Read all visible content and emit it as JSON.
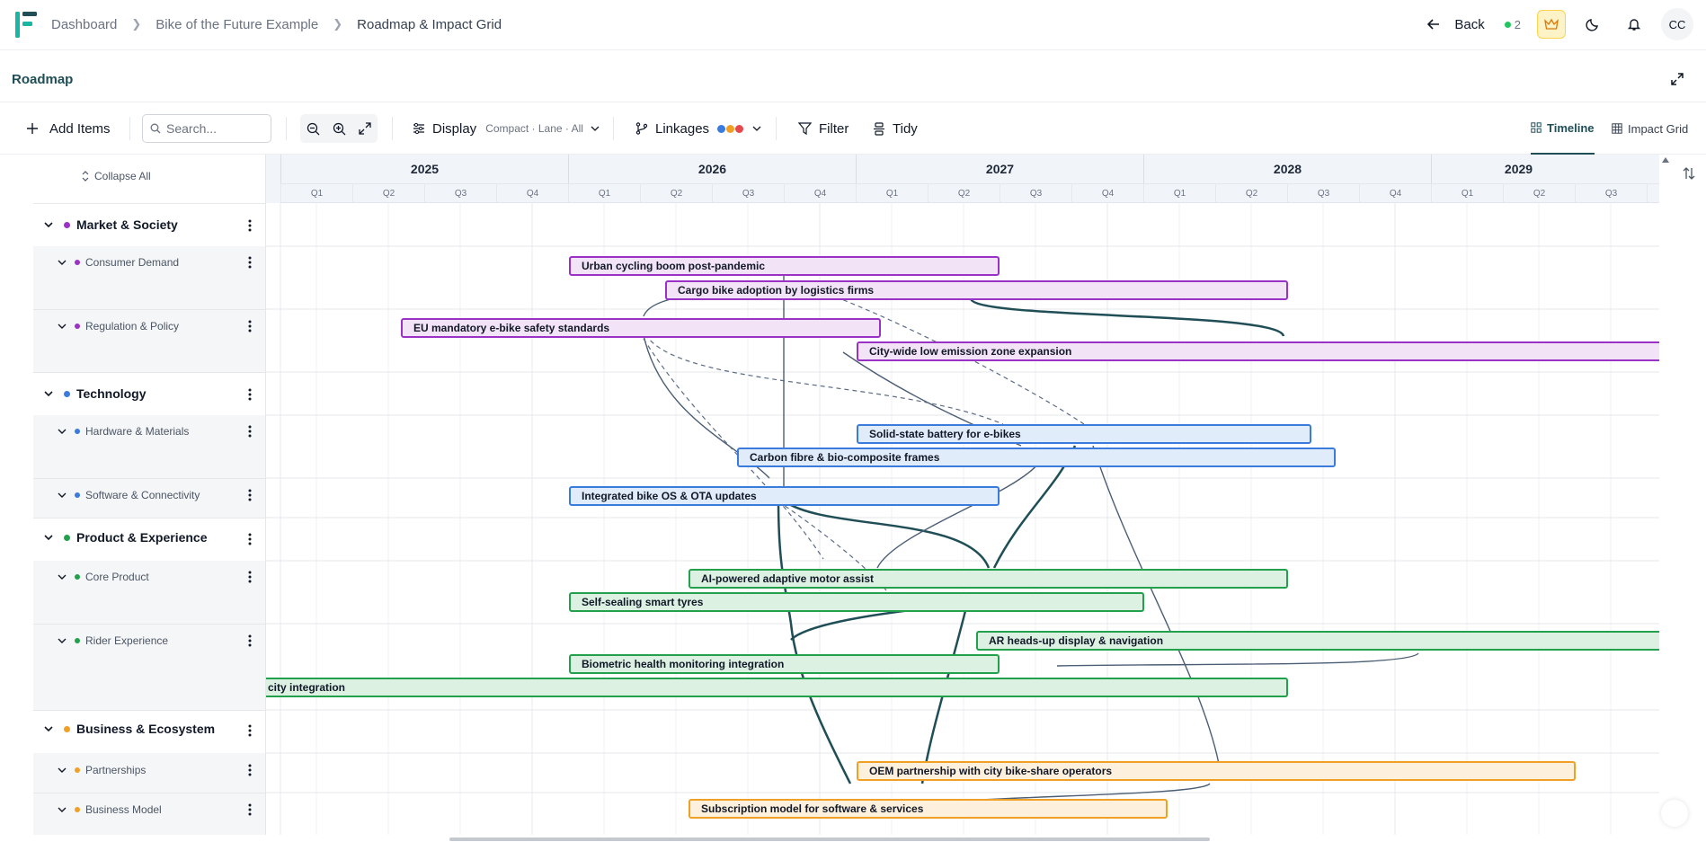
{
  "breadcrumb": {
    "items": [
      "Dashboard",
      "Bike of the Future Example"
    ],
    "current": "Roadmap & Impact Grid"
  },
  "topbar": {
    "back_label": "Back",
    "presence_count": "2",
    "avatar_initials": "CC"
  },
  "section": {
    "title": "Roadmap"
  },
  "toolbar": {
    "add_items": "Add Items",
    "search_placeholder": "Search...",
    "display_label": "Display",
    "display_sub": "Compact · Lane · All",
    "linkages_label": "Linkages",
    "filter_label": "Filter",
    "tidy_label": "Tidy",
    "view_timeline": "Timeline",
    "view_impact": "Impact Grid"
  },
  "colors": {
    "accent": "#1f4e57",
    "market": "#9a32c6",
    "technology": "#3a7bdc",
    "product": "#22a04b",
    "business": "#f0a025",
    "link": "#1f4e57"
  },
  "roadmap": {
    "collapse_all": "Collapse All",
    "years": [
      "2025",
      "2026",
      "2027",
      "2028",
      "2029"
    ],
    "quarters": [
      "Q1",
      "Q2",
      "Q3",
      "Q4"
    ],
    "groups": [
      {
        "label": "Market & Society",
        "color": "#9a32c6",
        "subs": [
          "Consumer Demand",
          "Regulation & Policy"
        ]
      },
      {
        "label": "Technology",
        "color": "#3a7bdc",
        "subs": [
          "Hardware & Materials",
          "Software & Connectivity"
        ]
      },
      {
        "label": "Product & Experience",
        "color": "#22a04b",
        "subs": [
          "Core Product",
          "Rider Experience"
        ]
      },
      {
        "label": "Business & Ecosystem",
        "color": "#f0a025",
        "subs": [
          "Partnerships",
          "Business Model"
        ]
      }
    ],
    "items": [
      {
        "label": "Urban cycling boom post-pandemic"
      },
      {
        "label": "Cargo bike adoption by logistics firms"
      },
      {
        "label": "EU mandatory e-bike safety standards"
      },
      {
        "label": "City-wide low emission zone expansion"
      },
      {
        "label": "Solid-state battery for e-bikes"
      },
      {
        "label": "Carbon fibre & bio-composite frames"
      },
      {
        "label": "Integrated bike OS & OTA updates"
      },
      {
        "label": "AI-powered adaptive motor assist"
      },
      {
        "label": "Self-sealing smart tyres"
      },
      {
        "label": "AR heads-up display & navigation"
      },
      {
        "label": "Biometric health monitoring integration"
      },
      {
        "label": "city integration"
      },
      {
        "label": "OEM partnership with city bike-share operators"
      },
      {
        "label": "Subscription model for software & services"
      }
    ]
  }
}
